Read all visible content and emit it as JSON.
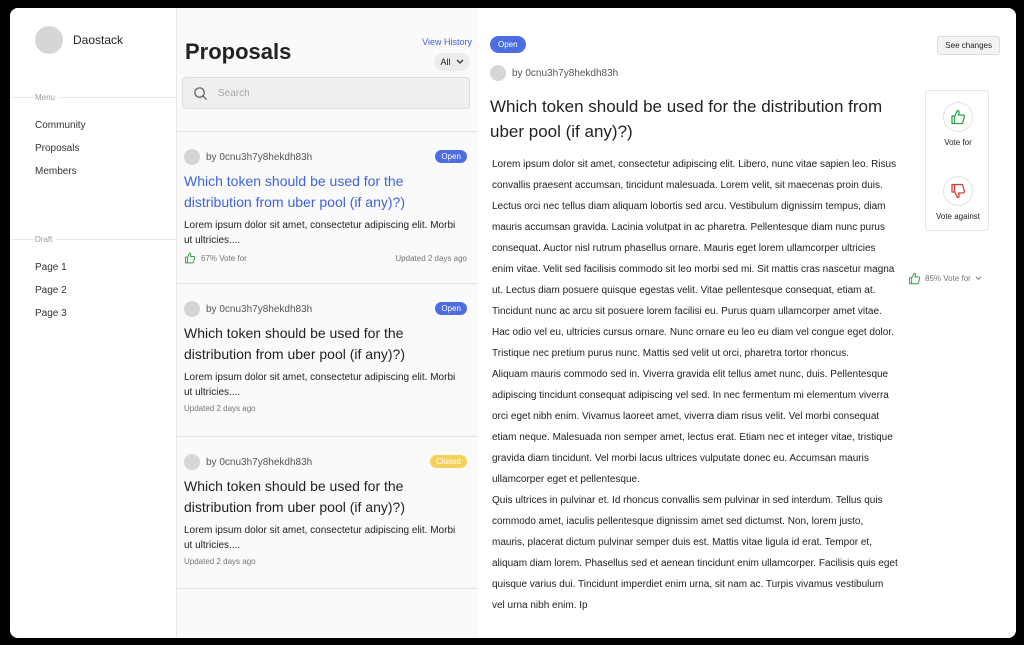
{
  "brand": {
    "name": "Daostack"
  },
  "sidebar": {
    "menu_label": "Menu",
    "items": [
      {
        "label": "Community"
      },
      {
        "label": "Proposals"
      },
      {
        "label": "Members"
      }
    ],
    "draft_label": "Draft",
    "drafts": [
      {
        "label": "Page 1"
      },
      {
        "label": "Page 2"
      },
      {
        "label": "Page 3"
      }
    ]
  },
  "list": {
    "title": "Proposals",
    "history_link": "View History",
    "filter_value": "All",
    "search_placeholder": "Search",
    "cards": [
      {
        "author": "by 0cnu3h7y8hekdh83h",
        "status": "Open",
        "title": "Which token should be used for the distribution from uber pool (if any)?)",
        "excerpt": "Lorem ipsum dolor sit amet, consectetur adipiscing elit. Morbi ut ultricies....",
        "vote": "67% Vote for",
        "updated": "Updated 2 days ago"
      },
      {
        "author": "by 0cnu3h7y8hekdh83h",
        "status": "Open",
        "title": "Which token should be used for the distribution from uber pool (if any)?)",
        "excerpt": "Lorem ipsum dolor sit amet, consectetur adipiscing elit. Morbi ut ultricies....",
        "updated": "Updated 2 days ago"
      },
      {
        "author": "by 0cnu3h7y8hekdh83h",
        "status": "Closed",
        "title": "Which token should be used for the distribution from uber pool (if any)?)",
        "excerpt": "Lorem ipsum dolor sit amet, consectetur adipiscing elit. Morbi ut ultricies....",
        "updated": "Updated 2 days ago"
      }
    ]
  },
  "detail": {
    "status": "Open",
    "see_changes": "See changes",
    "author": "by 0cnu3h7y8hekdh83h",
    "title": "Which token should be used for the distribution from uber pool (if any)?)",
    "paragraphs": [
      "Lorem ipsum dolor sit amet, consectetur adipiscing elit. Libero, nunc vitae sapien leo. Risus convallis praesent accumsan, tincidunt malesuada. Lorem velit, sit maecenas proin duis. Lectus orci nec tellus diam aliquam lobortis sed arcu. Vestibulum dignissim tempus, diam mauris accumsan gravida. Lacinia volutpat in ac pharetra. Pellentesque diam nunc purus consequat. Auctor nisl rutrum phasellus ornare. Mauris eget lorem ullamcorper ultricies enim vitae. Velit sed facilisis commodo sit leo morbi sed mi. Sit mattis cras nascetur magna ut. Lectus diam posuere quisque egestas velit. Vitae pellentesque consequat, etiam at. Tincidunt nunc ac arcu sit posuere lorem facilisi eu. Purus quam ullamcorper amet vitae. Hac odio vel eu, ultricies cursus ornare. Nunc ornare eu leo eu diam vel congue eget dolor. Tristique nec pretium purus nunc. Mattis sed velit ut orci, pharetra tortor rhoncus.",
      "Aliquam mauris commodo sed in. Viverra gravida elit tellus amet nunc, duis. Pellentesque adipiscing tincidunt consequat adipiscing vel sed. In nec fermentum mi elementum viverra orci eget nibh enim. Vivamus laoreet amet, viverra diam risus velit. Vel morbi consequat etiam neque. Malesuada non semper amet, lectus erat. Etiam nec et integer vitae, tristique gravida diam tincidunt. Vel morbi lacus ultrices vulputate donec eu. Accumsan mauris ullamcorper eget et pellentesque.",
      "Quis ultrices in pulvinar et. Id rhoncus convallis sem pulvinar in sed interdum. Tellus quis commodo amet, iaculis pellentesque dignissim amet sed dictumst. Non, lorem justo, mauris, placerat dictum pulvinar semper duis est. Mattis vitae ligula id erat. Tempor et, aliquam diam lorem. Phasellus sed et aenean tincidunt enim ullamcorper. Facilisis quis eget quisque varius dui. Tincidunt imperdiet enim urna, sit nam ac. Turpis vivamus vestibulum vel urna nibh enim. Ip"
    ],
    "vote_for_label": "Vote for",
    "vote_against_label": "Vote against",
    "vote_percent": "85% Vote for"
  },
  "colors": {
    "accent": "#3f63d9",
    "badge_open": "#4d6de3",
    "badge_closed": "#f3d05a",
    "thumb_up": "#2e9e47",
    "thumb_down": "#d23c3c"
  },
  "icons": [
    "search-icon",
    "chevron-down-icon",
    "thumbs-up-icon",
    "thumbs-down-icon"
  ]
}
